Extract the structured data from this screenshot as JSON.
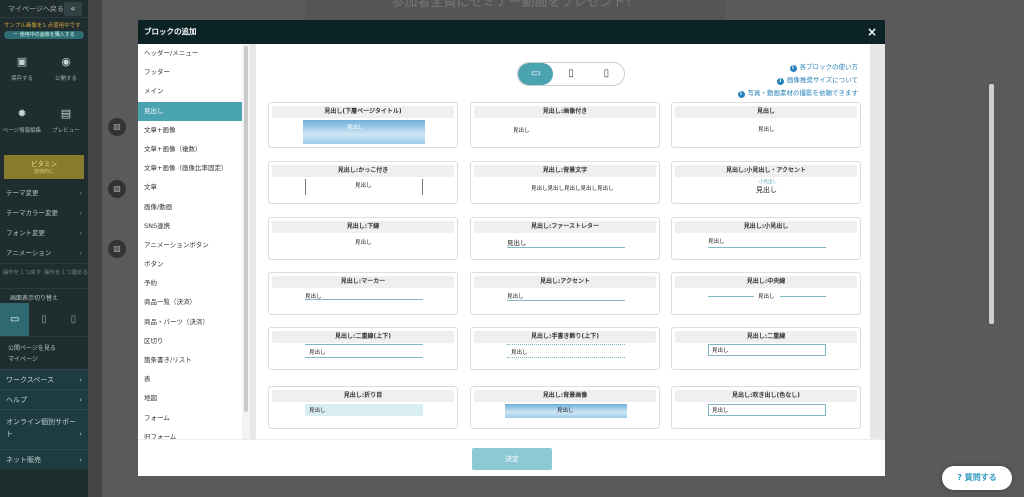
{
  "sidebar": {
    "back": "マイページへ戻る",
    "back_icon": "double-chevron-left-icon",
    "sample_note": "サンプル画像を1 点使用中です",
    "buy_pill": "ー 使用中の画像を購入する",
    "tools": [
      {
        "icon": "save-icon",
        "label": "保存する"
      },
      {
        "icon": "publish-icon",
        "label": "公開する"
      },
      {
        "icon": "gear-icon",
        "label": "ページ情報編集"
      },
      {
        "icon": "preview-icon",
        "label": "プレビュー"
      }
    ],
    "vitamin": {
      "title": "ビタミン",
      "sub": "技術的に"
    },
    "menu": [
      "テーマ変更",
      "テーマカラー変更",
      "フォント変更",
      "アニメーション"
    ],
    "undo": [
      "操作を１つ戻す",
      "操作を１つ進める"
    ],
    "display_switch": "画面表示切り替え",
    "links": [
      "公開ページを見る",
      "マイページ"
    ],
    "sections": [
      "ワークスペース",
      "ヘルプ",
      "オンライン個別サポート",
      "ネット販売"
    ]
  },
  "canvas_heading": "参加者全員にセミナー動画をプレゼント！",
  "help_button": "質問する",
  "modal": {
    "title": "ブロックの追加",
    "close": "×",
    "categories": [
      "ヘッダー/メニュー",
      "フッター",
      "メイン",
      "見出し",
      "文章+画像",
      "文章+画像（複数）",
      "文章+画像（画像比率固定）",
      "文章",
      "画像/動画",
      "SNS連携",
      "アニメーションボタン",
      "ボタン",
      "予約",
      "商品一覧（決済）",
      "商品・パーツ（決済）",
      "区切り",
      "箇条書き/リスト",
      "表",
      "地図",
      "フォーム",
      "旧フォーム"
    ],
    "selected": "見出し",
    "help_links": [
      "各ブロックの使い方",
      "画像推奨サイズについて",
      "写真・動画素材の撮影を依頼できます"
    ],
    "cards": [
      {
        "title": "見出し(下層ページタイトル)",
        "preview": "見出し"
      },
      {
        "title": "見出し:画像付き",
        "preview": "見出し"
      },
      {
        "title": "見出し",
        "preview": "見出し"
      },
      {
        "title": "見出し:かっこ付き",
        "preview": "見出し"
      },
      {
        "title": "見出し:背景文字",
        "preview": "見出し見出し見出し見出し見出し"
      },
      {
        "title": "見出し:小見出し・アクセント",
        "preview": "見出し",
        "sub": "小見出し"
      },
      {
        "title": "見出し:下線",
        "preview": "見出し"
      },
      {
        "title": "見出し:ファーストレター",
        "preview": "見出し"
      },
      {
        "title": "見出し:小見出し",
        "preview": "見出し"
      },
      {
        "title": "見出し:マーカー",
        "preview": "見出し"
      },
      {
        "title": "見出し:アクセント",
        "preview": "見出し"
      },
      {
        "title": "見出し:中央線",
        "preview": "見出し"
      },
      {
        "title": "見出し:二重線(上下)",
        "preview": "見出し"
      },
      {
        "title": "見出し:手書き飾り(上下)",
        "preview": "見出し"
      },
      {
        "title": "見出し:二重線",
        "preview": "見出し"
      },
      {
        "title": "見出し:折り目",
        "preview": "見出し"
      },
      {
        "title": "見出し:背景画像",
        "preview": "見出し"
      },
      {
        "title": "見出し:吹き出し(色なし)",
        "preview": "見出し"
      }
    ],
    "decide": "決定"
  }
}
